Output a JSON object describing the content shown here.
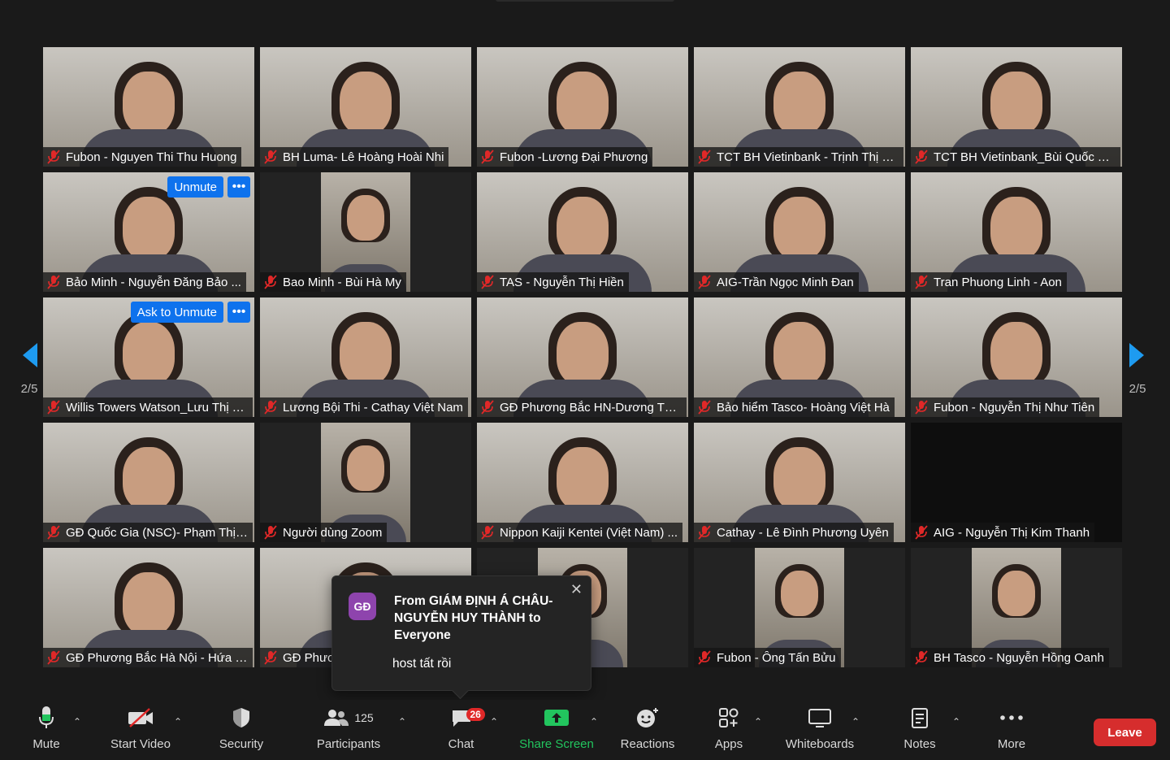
{
  "participants": [
    {
      "name": "Fubon - Nguyen Thi Thu Huong",
      "kind": "video"
    },
    {
      "name": "BH Luma- Lê Hoàng Hoài Nhi",
      "kind": "video"
    },
    {
      "name": "Fubon -Lương Đại Phương",
      "kind": "video"
    },
    {
      "name": "TCT BH Vietinbank - Trịnh Thị L...",
      "kind": "video"
    },
    {
      "name": "TCT BH Vietinbank_Bùi Quốc Tu...",
      "kind": "video"
    },
    {
      "name": "Bảo Minh - Nguyễn Đăng Bảo ...",
      "kind": "video",
      "button": "Unmute"
    },
    {
      "name": "Bao Minh - Bùi Hà My",
      "kind": "pillar"
    },
    {
      "name": "TAS - Nguyễn Thị Hiền",
      "kind": "video"
    },
    {
      "name": "AIG-Trần Ngọc Minh Đan",
      "kind": "video"
    },
    {
      "name": "Tran Phuong Linh - Aon",
      "kind": "video"
    },
    {
      "name": "Willis Towers Watson_Lưu Thị T...",
      "kind": "video",
      "button": "Ask to Unmute"
    },
    {
      "name": "Lương Bội Thi - Cathay Việt Nam",
      "kind": "video"
    },
    {
      "name": "GĐ Phương Bắc HN-Dương Thị ...",
      "kind": "video"
    },
    {
      "name": "Bảo hiểm Tasco- Hoàng Việt Hà",
      "kind": "video"
    },
    {
      "name": "Fubon - Nguyễn Thị Như Tiên",
      "kind": "video"
    },
    {
      "name": "GĐ Quốc Gia (NSC)- Phạm Thị ...",
      "kind": "video"
    },
    {
      "name": "Người dùng Zoom",
      "kind": "pillar"
    },
    {
      "name": "Nippon Kaiji Kentei (Việt Nam) ...",
      "kind": "video"
    },
    {
      "name": "Cathay - Lê Đình Phương Uyên",
      "kind": "video"
    },
    {
      "name": "AIG - Nguyễn Thị Kim Thanh",
      "kind": "black"
    },
    {
      "name": "GĐ Phương Bắc Hà Nội - Hứa N...",
      "kind": "video"
    },
    {
      "name": "GĐ Phươ",
      "kind": "video"
    },
    {
      "name": "",
      "kind": "pillar"
    },
    {
      "name": "Fubon - Ông Tấn Bửu",
      "kind": "pillar"
    },
    {
      "name": "BH Tasco - Nguyễn Hồng Oanh",
      "kind": "pillar"
    }
  ],
  "pager": {
    "left": "2/5",
    "right": "2/5"
  },
  "chat_popup": {
    "avatar": "GĐ",
    "from": "From GIÁM ĐỊNH Á CHÂU- NGUYỄN HUY THÀNH to Everyone",
    "message": "host tất rồi"
  },
  "toolbar": {
    "mute": "Mute",
    "start_video": "Start Video",
    "security": "Security",
    "participants": "Participants",
    "participant_count": "125",
    "chat": "Chat",
    "chat_badge": "26",
    "share_screen": "Share Screen",
    "reactions": "Reactions",
    "apps": "Apps",
    "whiteboards": "Whiteboards",
    "notes": "Notes",
    "more": "More",
    "leave": "Leave"
  },
  "colors": {
    "accent_blue": "#0e72ed",
    "leave_red": "#d62d2d",
    "share_green": "#22c55e",
    "muted_red": "#e02828"
  }
}
